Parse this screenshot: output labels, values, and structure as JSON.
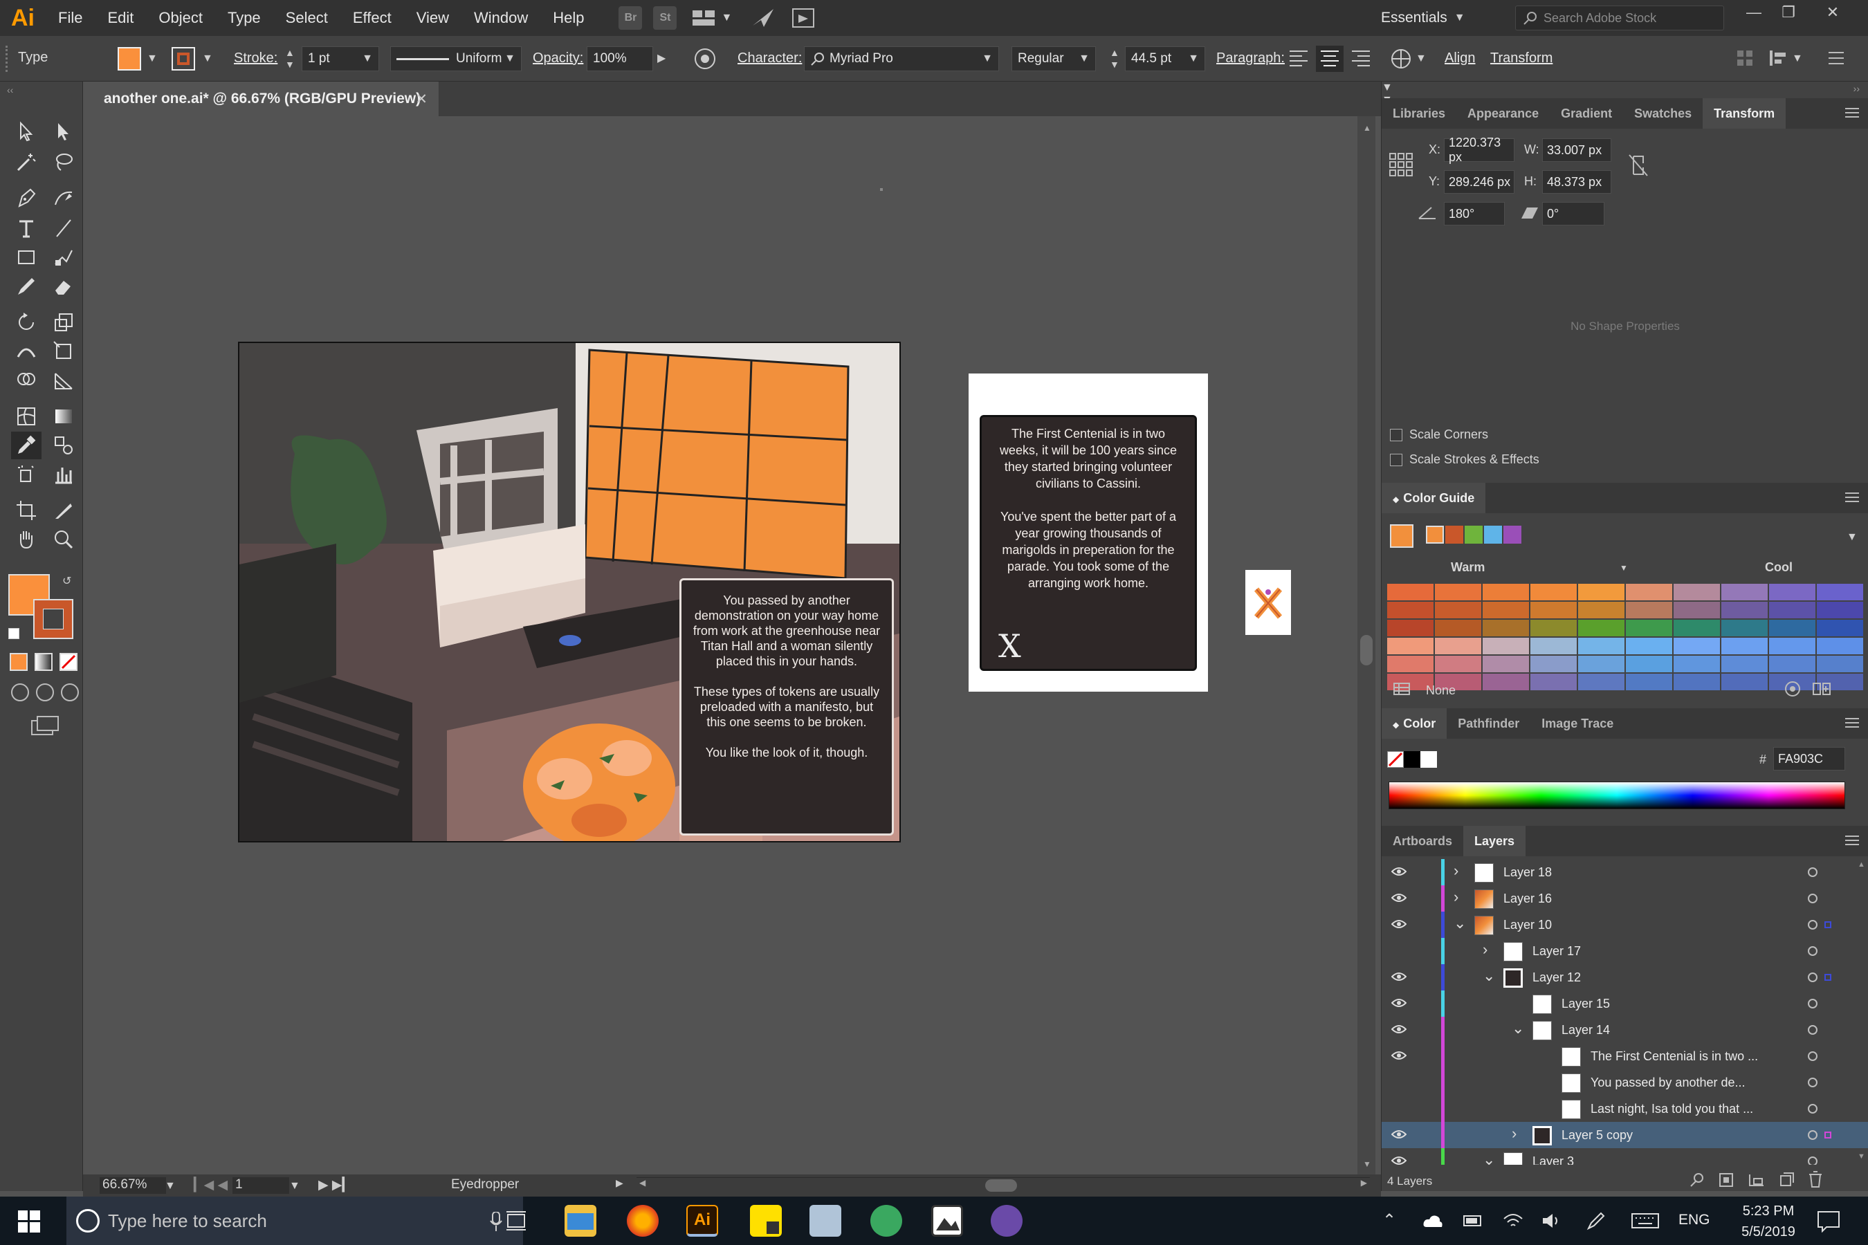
{
  "app": {
    "name": "Illustrator",
    "logo_text": "Ai"
  },
  "menu": [
    "File",
    "Edit",
    "Object",
    "Type",
    "Select",
    "Effect",
    "View",
    "Window",
    "Help"
  ],
  "menubar_icons": [
    "Br",
    "St"
  ],
  "workspace": {
    "label": "Essentials"
  },
  "stock_search": {
    "placeholder": "Search Adobe Stock"
  },
  "control": {
    "selection_type": "Type",
    "fill_color": "#FA903C",
    "stroke_label": "Stroke:",
    "stroke_weight": "1 pt",
    "stroke_profile": "Uniform",
    "opacity_label": "Opacity:",
    "opacity_value": "100%",
    "character_label": "Character:",
    "font_family": "Myriad Pro",
    "font_style": "Regular",
    "font_size": "44.5 pt",
    "paragraph_label": "Paragraph:",
    "align_link": "Align",
    "transform_link": "Transform"
  },
  "document": {
    "tab_title": "another one.ai* @ 66.67% (RGB/GPU Preview)"
  },
  "artboard1": {
    "text": "You passed by another demonstration on your way home from work at the greenhouse near Titan Hall and a woman silently placed this in your hands.\n\nThese types of tokens are usually preloaded with a manifesto, but this one seems to be broken.\n\nYou like the look of it, though."
  },
  "artboard2": {
    "text": "The First Centenial is in two weeks, it will be 100 years since they started bringing volunteer civilians to Cassini.\n\nYou've spent the better part of a year growing thousands of marigolds in preperation for the parade. You took some of the arranging work home.",
    "icon": "X"
  },
  "panels": {
    "top_tabs": [
      "Libraries",
      "Appearance",
      "Gradient",
      "Swatches",
      "Transform"
    ],
    "transform": {
      "x_label": "X:",
      "x": "1220.373 px",
      "w_label": "W:",
      "w": "33.007 px",
      "y_label": "Y:",
      "y": "289.246 px",
      "h_label": "H:",
      "h": "48.373 px",
      "rotate": "180°",
      "shear": "0°",
      "no_shape": "No Shape Properties",
      "scale_corners": "Scale Corners",
      "scale_strokes": "Scale Strokes & Effects"
    },
    "color_guide": {
      "title": "Color Guide",
      "warm": "Warm",
      "cool": "Cool",
      "none_label": "None",
      "harmony": [
        "#F28F3C",
        "#C9572A",
        "#6FB43C",
        "#5FB4E8",
        "#9A4FB8"
      ],
      "grid": [
        [
          "#E66A3A",
          "#E8733A",
          "#EC7E38",
          "#F18A3A",
          "#F29A3C",
          "#E0906E",
          "#B48A9C",
          "#9478B8",
          "#7B68C4",
          "#6A62CC"
        ],
        [
          "#C4502C",
          "#C85C2C",
          "#CD6A2C",
          "#CF7A2E",
          "#C8822E",
          "#B87A5E",
          "#8E6A86",
          "#6E5CA0",
          "#5C52A8",
          "#4C48AC"
        ],
        [
          "#B8452A",
          "#B55A26",
          "#A8702A",
          "#8C8A2C",
          "#5AA02C",
          "#3E9A4C",
          "#2E8A6A",
          "#2E7A8A",
          "#2E6AA0",
          "#3054B0"
        ],
        [
          "#F09A7A",
          "#E8A08E",
          "#C8B0B8",
          "#9CB8D6",
          "#74B4E8",
          "#6AB0F0",
          "#74A8F4",
          "#6CA0F0",
          "#6498EC",
          "#5E90E8"
        ],
        [
          "#E07A6A",
          "#D07C82",
          "#B08CA8",
          "#8A9CCA",
          "#6AA2DC",
          "#5AA0E0",
          "#6096DE",
          "#5E8CD8",
          "#5A84D2",
          "#5680CC"
        ],
        [
          "#C85A5C",
          "#B85C74",
          "#9A6494",
          "#7A70B0",
          "#5E78C0",
          "#527AC4",
          "#5274C0",
          "#526CBA",
          "#5266B4",
          "#5262AE"
        ]
      ]
    },
    "color": {
      "tabs": [
        "Color",
        "Pathfinder",
        "Image Trace"
      ],
      "hex": "FA903C"
    },
    "layers": {
      "tabs": [
        "Artboards",
        "Layers"
      ],
      "count": "4 Layers",
      "rows": [
        {
          "name": "Layer 18",
          "indent": 0,
          "eye": true,
          "expand": "collapsed",
          "color": "#49d2e6",
          "thumb": "white"
        },
        {
          "name": "Layer 16",
          "indent": 0,
          "eye": true,
          "expand": "collapsed",
          "color": "#d247d8",
          "thumb": "art"
        },
        {
          "name": "Layer 10",
          "indent": 0,
          "eye": true,
          "expand": "expanded",
          "color": "#3d4ad8",
          "thumb": "art"
        },
        {
          "name": "Layer 17",
          "indent": 1,
          "eye": false,
          "expand": "collapsed",
          "color": "#49d2e6",
          "thumb": "white"
        },
        {
          "name": "Layer 12",
          "indent": 1,
          "eye": true,
          "expand": "expanded",
          "color": "#3d4ad8",
          "thumb": "dark"
        },
        {
          "name": "Layer 15",
          "indent": 2,
          "eye": true,
          "expand": "none",
          "color": "#49d2e6",
          "thumb": "white"
        },
        {
          "name": "Layer 14",
          "indent": 2,
          "eye": true,
          "expand": "expanded",
          "color": "#d247d8",
          "thumb": "white"
        },
        {
          "name": "The First Centenial is in two ...",
          "indent": 3,
          "eye": true,
          "expand": "none",
          "color": "#d247d8",
          "thumb": "white"
        },
        {
          "name": "You passed by another  de...",
          "indent": 3,
          "eye": false,
          "expand": "none",
          "color": "#d247d8",
          "thumb": "white"
        },
        {
          "name": "Last night, Isa told you that ...",
          "indent": 3,
          "eye": false,
          "expand": "none",
          "color": "#d247d8",
          "thumb": "white"
        },
        {
          "name": "Layer 5 copy",
          "indent": 2,
          "eye": true,
          "expand": "collapsed",
          "color": "#d247d8",
          "thumb": "dark",
          "selected": true
        },
        {
          "name": "Layer 3",
          "indent": 1,
          "eye": true,
          "expand": "expanded",
          "color": "#49d94a",
          "thumb": "white"
        }
      ]
    }
  },
  "status": {
    "zoom": "66.67%",
    "artboard": "1",
    "tool": "Eyedropper"
  },
  "taskbar": {
    "search_placeholder": "Type here to search",
    "language": "ENG",
    "time": "5:23 PM",
    "date": "5/5/2019"
  }
}
